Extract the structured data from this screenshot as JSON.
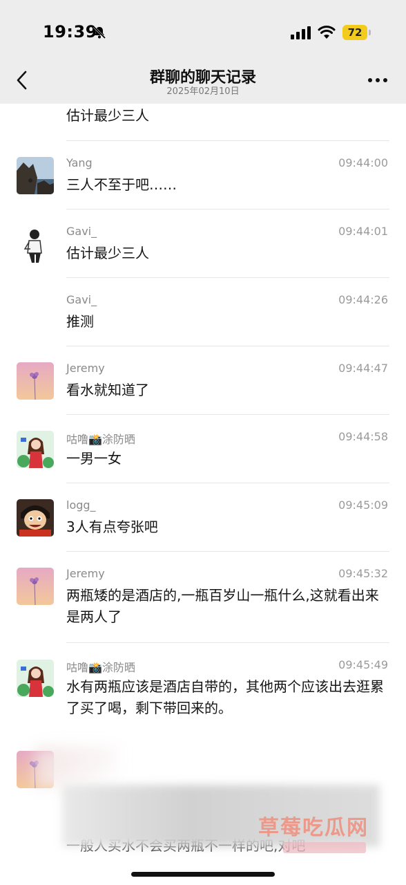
{
  "status_bar": {
    "time": "19:39",
    "battery": "72"
  },
  "nav": {
    "title": "群聊的聊天记录",
    "subtitle": "2025年02月10日"
  },
  "top_partial": {
    "text": "估计最少三人"
  },
  "messages": [
    {
      "name": "Yang",
      "time": "09:44:00",
      "text": "三人不至于吧……",
      "avatar": "landscape-avatar"
    },
    {
      "name": "Gavi_",
      "time": "09:44:01",
      "text": "估计最少三人",
      "avatar": "person-avatar"
    },
    {
      "name": "Gavi_",
      "time": "09:44:26",
      "text": "推测",
      "avatar": ""
    },
    {
      "name": "Jeremy",
      "time": "09:44:47",
      "text": "看水就知道了",
      "avatar": "flower-avatar"
    },
    {
      "name": "咕噜📸涂防晒",
      "time": "09:44:58",
      "text": "一男一女",
      "avatar": "cartoon-girl-avatar"
    },
    {
      "name": "logg_",
      "time": "09:45:09",
      "text": "3人有点夸张吧",
      "avatar": "cartoon-boy-avatar"
    },
    {
      "name": "Jeremy",
      "time": "09:45:32",
      "text": "两瓶矮的是酒店的,一瓶百岁山一瓶什么,这就看出来是两人了",
      "avatar": "flower-avatar"
    },
    {
      "name": "咕噜📸涂防晒",
      "time": "09:45:49",
      "text": "水有两瓶应该是酒店自带的，其他两个应该出去逛累了买了喝，剩下带回来的。",
      "avatar": "cartoon-girl-avatar"
    }
  ],
  "bottom_partial": {
    "text": "一般人买水不会买两瓶不一样的吧,对吧",
    "avatar": "flower-avatar"
  },
  "watermark": "草莓吃瓜网",
  "colors": {
    "nav_bg": "#ededed",
    "battery": "#f2cb1d",
    "watermark": "#f08a78"
  }
}
